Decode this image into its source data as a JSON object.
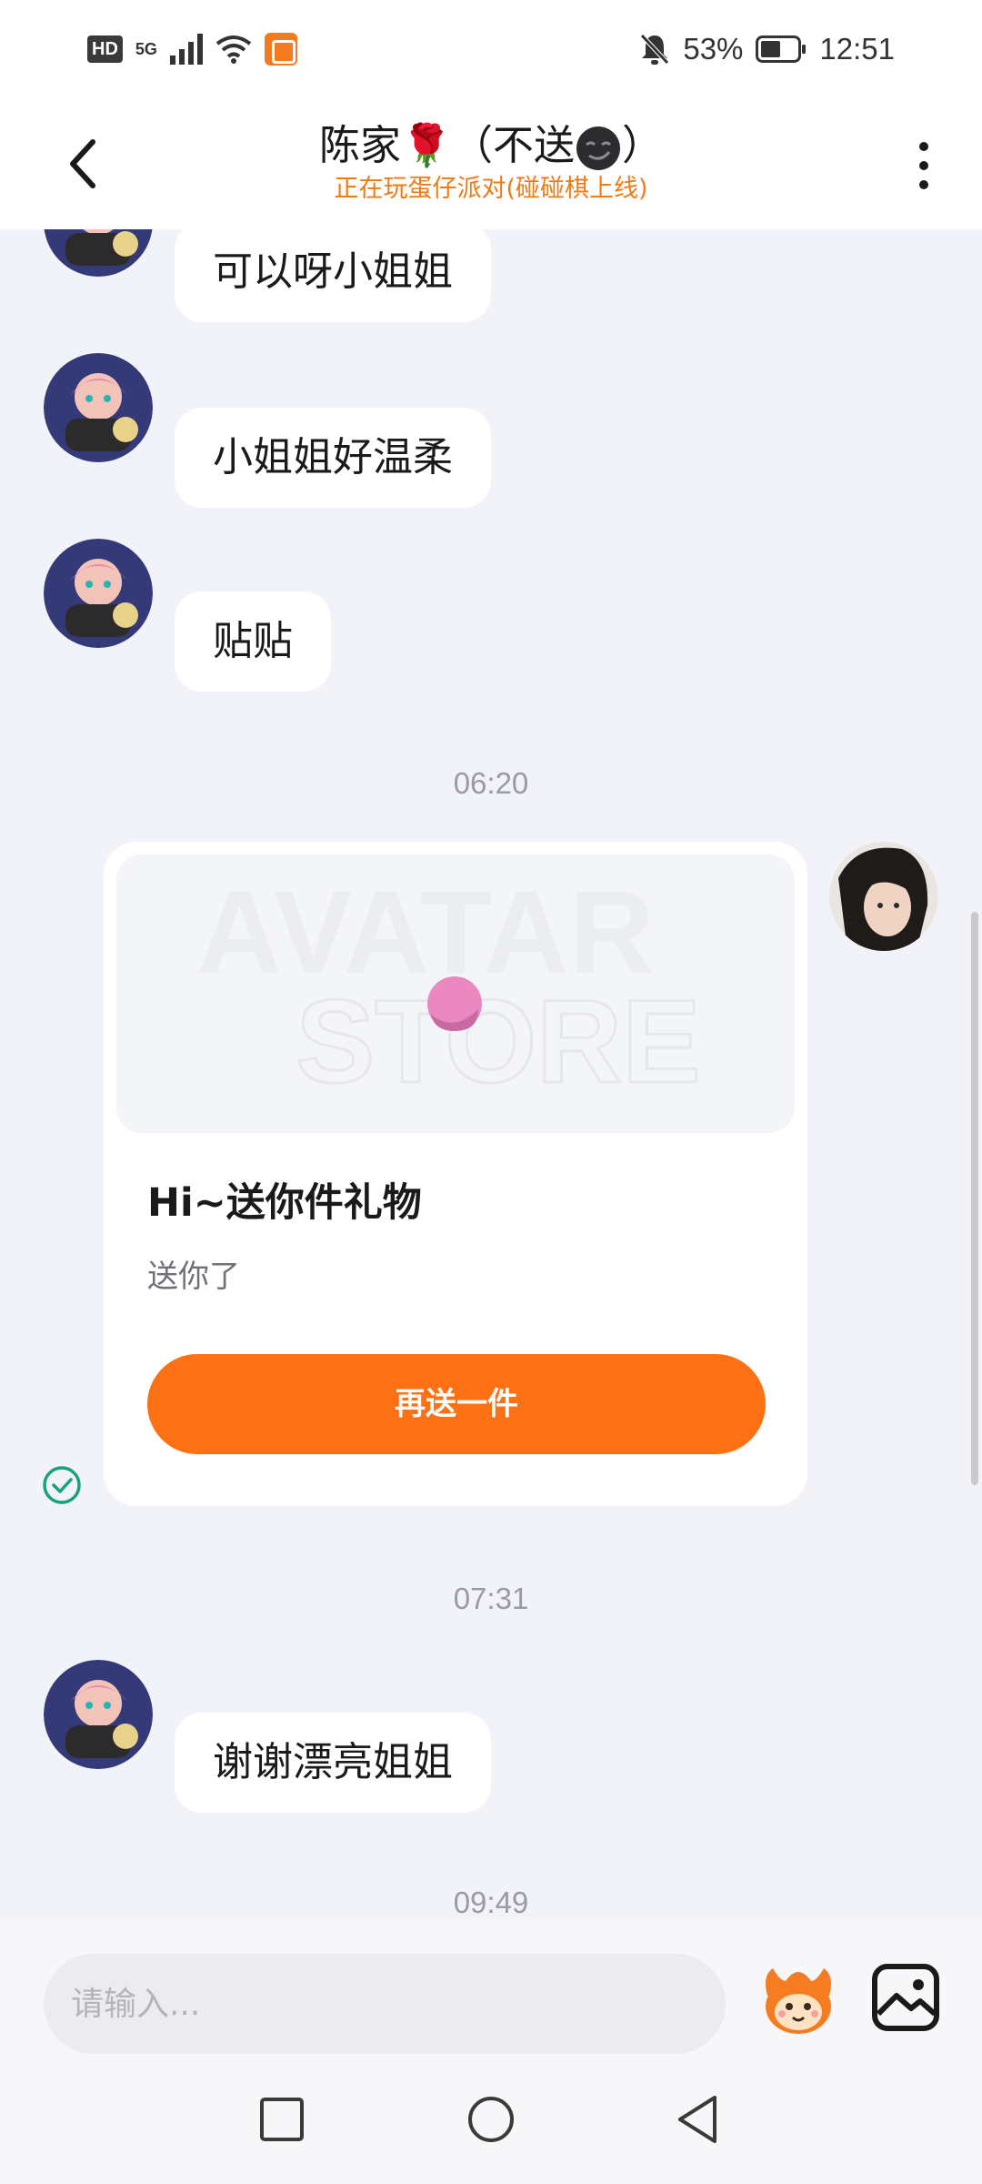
{
  "status_bar": {
    "hd": "HD",
    "network": "5G",
    "battery": "53%",
    "time": "12:51"
  },
  "header": {
    "title": "陈家🌹（不送",
    "title_end": "）",
    "subtitle": "正在玩蛋仔派对(碰碰棋上线)"
  },
  "messages": {
    "m1": "可以呀小姐姐",
    "m2": "小姐姐好温柔",
    "m3": "贴贴",
    "t1": "06:20",
    "t2": "07:31",
    "m4": "谢谢漂亮姐姐",
    "t3": "09:49"
  },
  "gift_card": {
    "watermark_top": "AVATAR",
    "watermark_bottom": "STORE",
    "title": "Hi~送你件礼物",
    "description": "送你了",
    "button": "再送一件"
  },
  "input": {
    "placeholder": "请输入..."
  },
  "colors": {
    "accent": "#fd7014",
    "subtitle": "#f07a14",
    "background": "#f2f3f8",
    "sent_check": "#16a37a"
  },
  "icons": {
    "back": "chevron-left-icon",
    "more": "more-vertical-icon",
    "mascot": "mascot-emoji-icon",
    "image": "image-icon",
    "nav_recent": "square-icon",
    "nav_home": "circle-icon",
    "nav_back": "triangle-back-icon"
  }
}
